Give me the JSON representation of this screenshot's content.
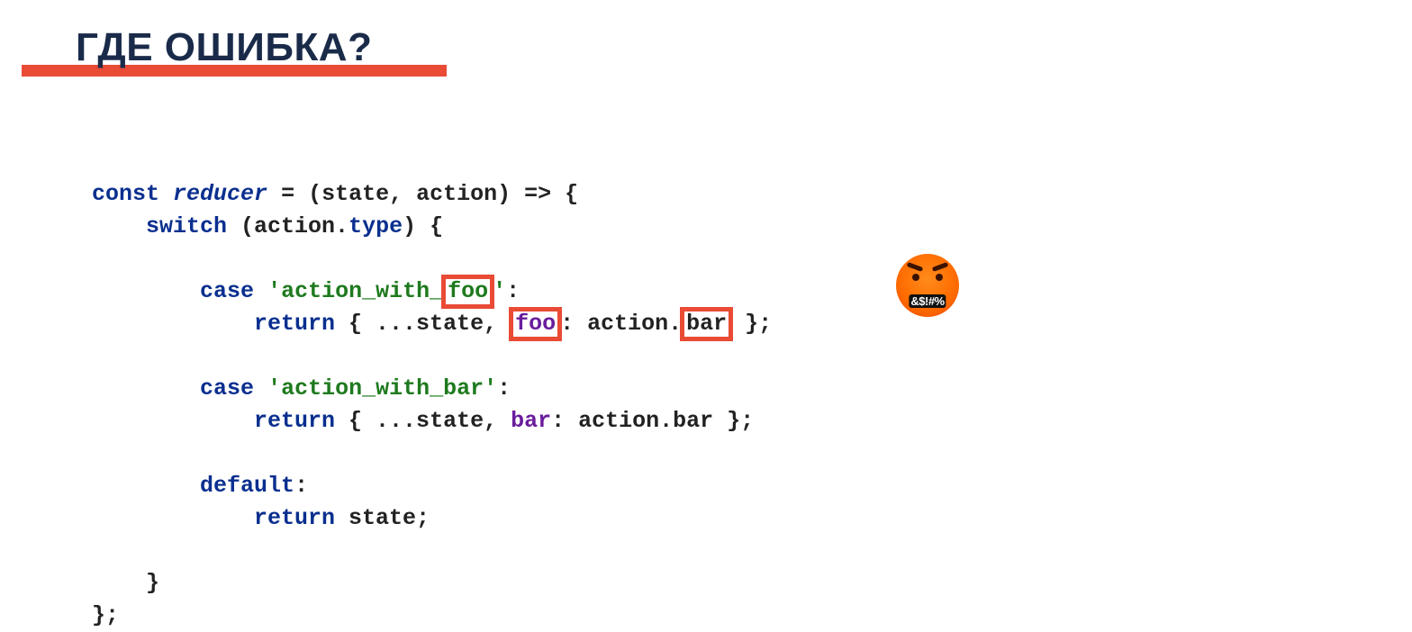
{
  "title": "ГДЕ ОШИБКА?",
  "code": {
    "l1": {
      "const": "const",
      "reducer": "reducer",
      "rest": " = (state, action) => {"
    },
    "l2": {
      "switch": "switch",
      "open": " (action.",
      "type": "type",
      "close": ") {"
    },
    "l3": {
      "case": "case",
      "str_pre": "'action_with_",
      "hl_foo": "foo",
      "str_post": "'",
      "colon": ":"
    },
    "l4": {
      "return": "return",
      "open": " { ...state, ",
      "hl_foo2": "foo",
      "mid": ": action.",
      "hl_bar": "bar",
      "close": " };"
    },
    "l5": {
      "case": "case",
      "str": "'action_with_bar'",
      "colon": ":"
    },
    "l6": {
      "return": "return",
      "open": " { ...state, ",
      "bar": "bar",
      "mid": ": action.bar };"
    },
    "l7": {
      "default": "default",
      "colon": ":"
    },
    "l8": {
      "return": "return",
      "rest": " state;"
    },
    "l9": {
      "brace": "}"
    },
    "l10": {
      "brace": "};"
    }
  },
  "emoji": {
    "name": "angry-censored-face",
    "mouth_text": "&$!#%"
  }
}
